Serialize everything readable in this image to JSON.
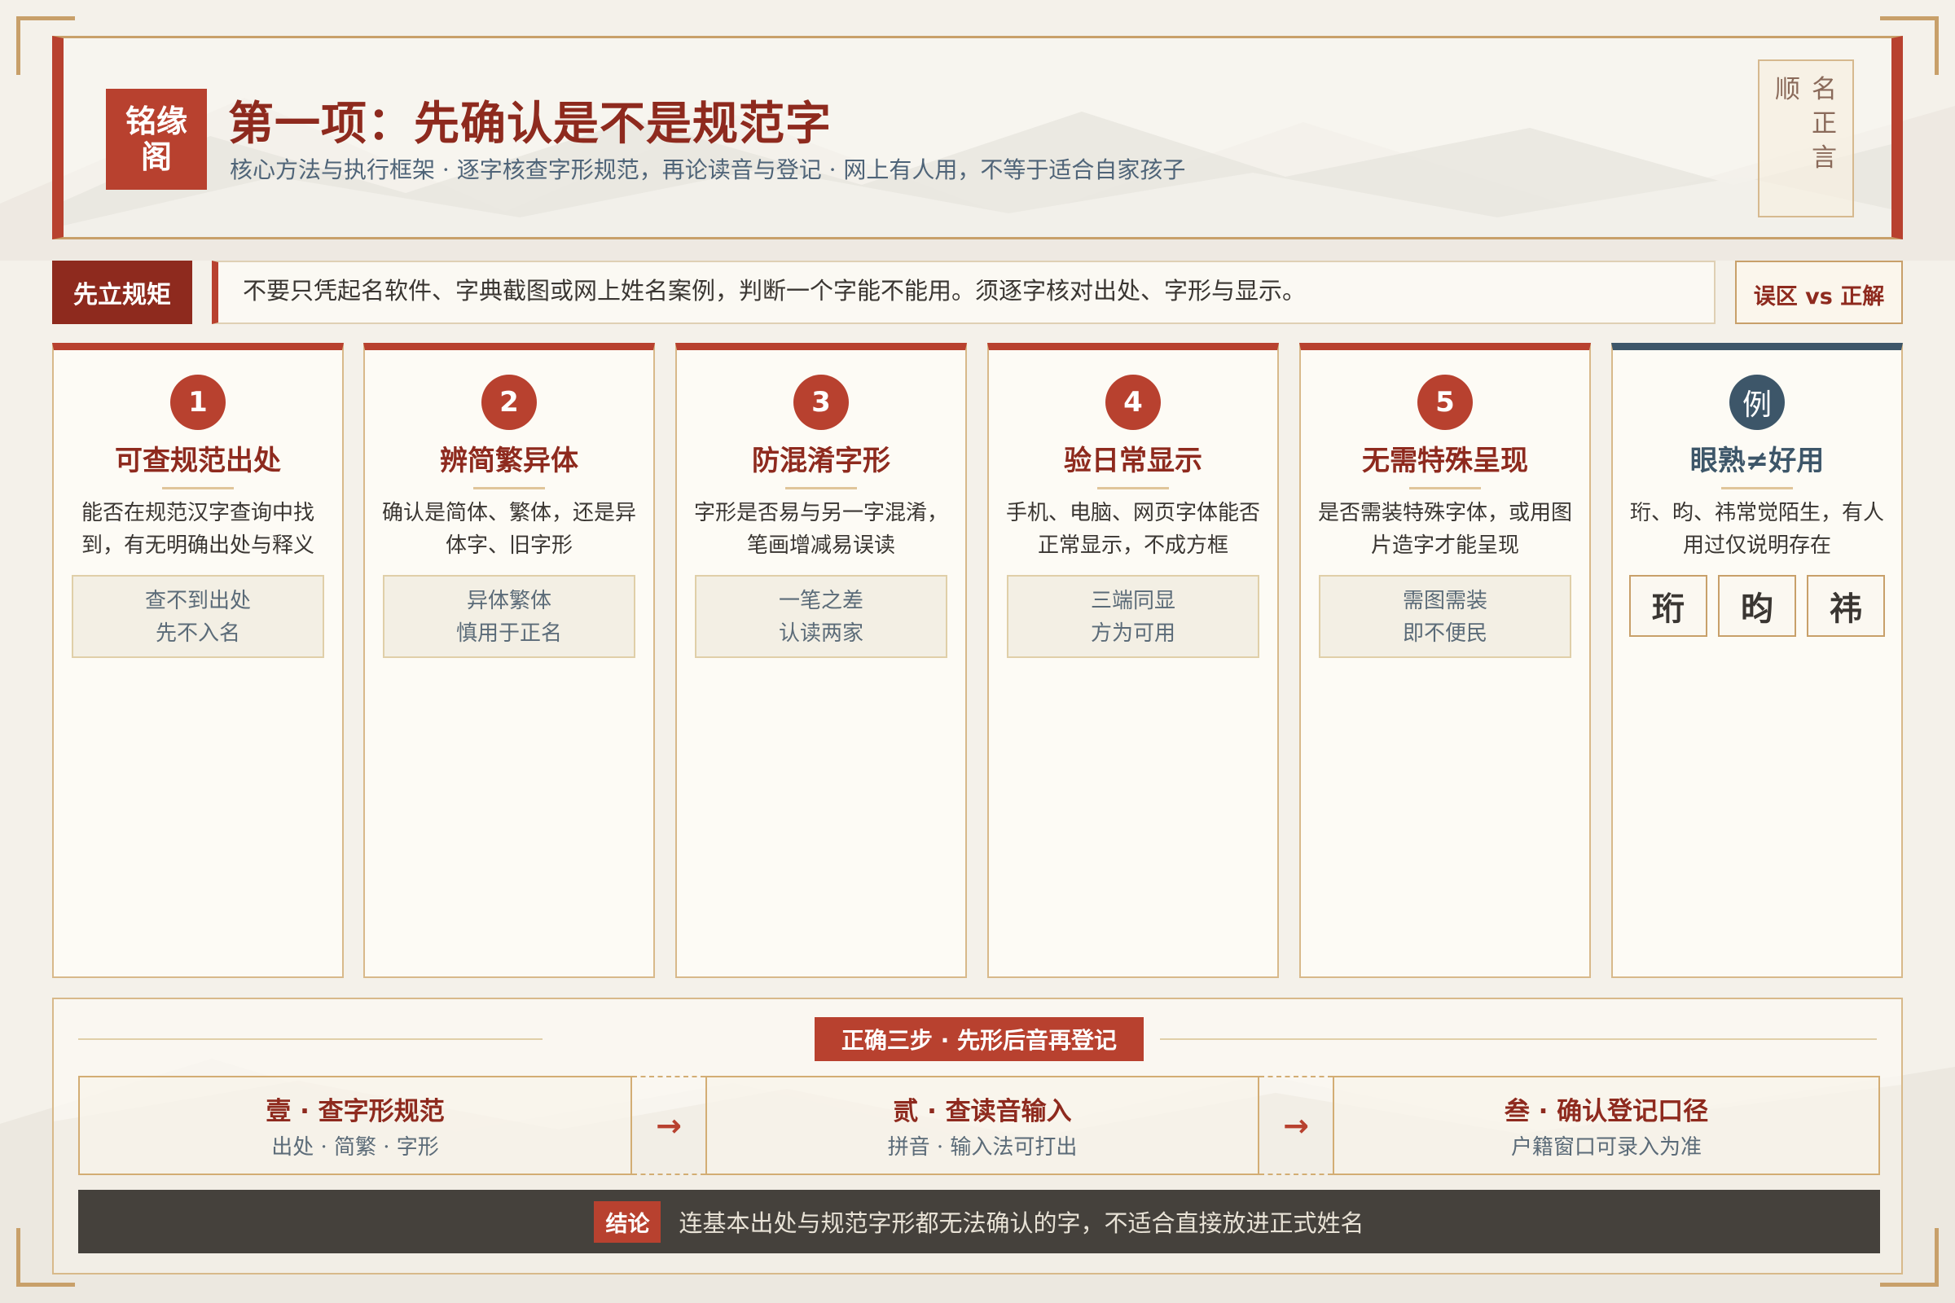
{
  "header": {
    "logo_line1": "铭缘",
    "logo_line2": "阁",
    "title": "第一项：先确认是不是规范字",
    "subtitle": "核心方法与执行框架 · 逐字核查字形规范，再论读音与登记 · 网上有人用，不等于适合自家孩子",
    "seal_col1": "名正言",
    "seal_col2": "顺"
  },
  "rule": {
    "tag": "先立规矩",
    "text": "不要只凭起名软件、字典截图或网上姓名案例，判断一个字能不能用。须逐字核对出处、字形与显示。",
    "button": "误区 vs 正解"
  },
  "cards": [
    {
      "num": "1",
      "title": "可查规范出处",
      "desc": "能否在规范汉字查询中找到，有无明确出处与释义",
      "note1": "查不到出处",
      "note2": "先不入名"
    },
    {
      "num": "2",
      "title": "辨简繁异体",
      "desc": "确认是简体、繁体，还是异体字、旧字形",
      "note1": "异体繁体",
      "note2": "慎用于正名"
    },
    {
      "num": "3",
      "title": "防混淆字形",
      "desc": "字形是否易与另一字混淆，笔画增减易误读",
      "note1": "一笔之差",
      "note2": "认读两家"
    },
    {
      "num": "4",
      "title": "验日常显示",
      "desc": "手机、电脑、网页字体能否正常显示，不成方框",
      "note1": "三端同显",
      "note2": "方为可用"
    },
    {
      "num": "5",
      "title": "无需特殊呈现",
      "desc": "是否需装特殊字体，或用图片造字才能呈现",
      "note1": "需图需装",
      "note2": "即不便民"
    }
  ],
  "example": {
    "num": "例",
    "title": "眼熟≠好用",
    "desc": "珩、昀、祎常觉陌生，有人用过仅说明存在",
    "chars": [
      "珩",
      "昀",
      "祎"
    ]
  },
  "bottom": {
    "tag": "正确三步 · 先形后音再登记",
    "steps": [
      {
        "title": "壹 · 查字形规范",
        "sub": "出处 · 简繁 · 字形"
      },
      {
        "title": "贰 · 查读音输入",
        "sub": "拼音 · 输入法可打出"
      },
      {
        "title": "叁 · 确认登记口径",
        "sub": "户籍窗口可录入为准"
      }
    ],
    "arrow": "→",
    "conclusion_tag": "结论",
    "conclusion_text": "连基本出处与规范字形都无法确认的字，不适合直接放进正式姓名"
  },
  "colors": {
    "accent_red": "#b8412f",
    "dark_red": "#8e2a1e",
    "slate_blue": "#3d5669",
    "gold_border": "#c8a06a",
    "background": "#f4f1ea"
  }
}
